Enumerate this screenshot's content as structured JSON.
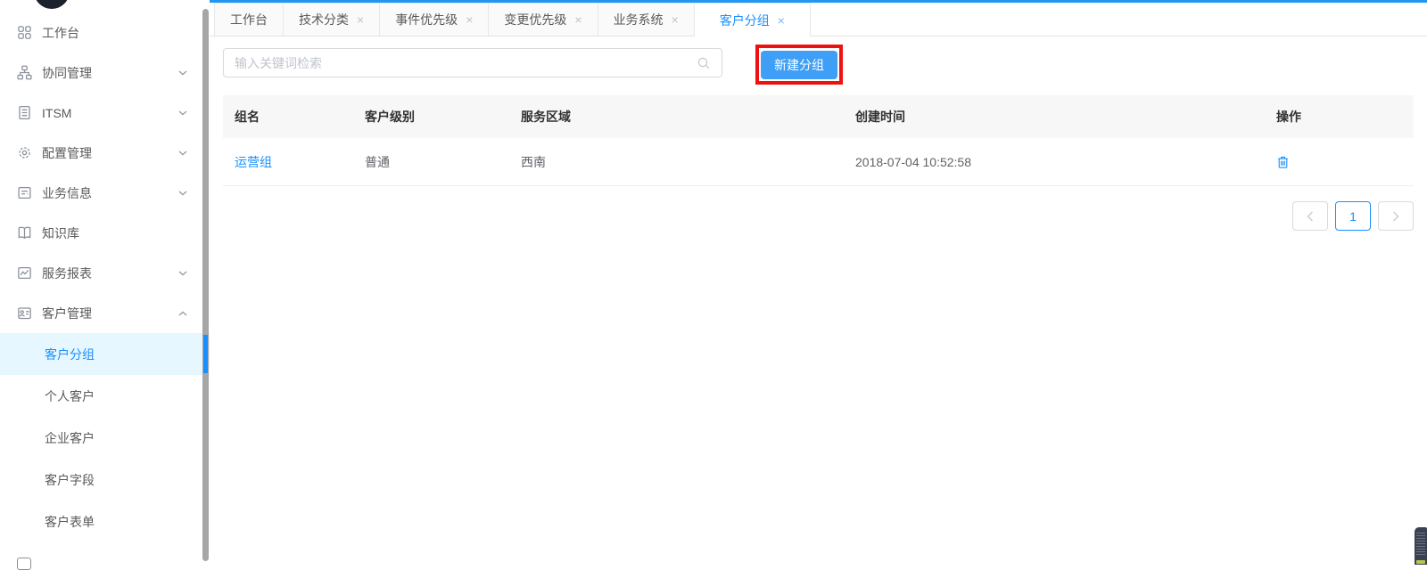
{
  "colors": {
    "accent": "#1890ff",
    "top_line": "#2196f3",
    "primary_button": "#3f9ef5",
    "annotation_box": "#ee1111",
    "active_item_bg": "#e6f7ff"
  },
  "sidebar": {
    "items": [
      {
        "label": "工作台",
        "icon": "grid-icon"
      },
      {
        "label": "协同管理",
        "icon": "org-chart-icon",
        "chevron": "down"
      },
      {
        "label": "ITSM",
        "icon": "document-icon",
        "chevron": "down"
      },
      {
        "label": "配置管理",
        "icon": "gear-icon",
        "chevron": "down"
      },
      {
        "label": "业务信息",
        "icon": "form-icon",
        "chevron": "down"
      },
      {
        "label": "知识库",
        "icon": "book-icon"
      },
      {
        "label": "服务报表",
        "icon": "report-chart-icon",
        "chevron": "down"
      },
      {
        "label": "客户管理",
        "icon": "id-card-icon",
        "chevron": "up",
        "expanded": true
      }
    ],
    "submenu": [
      {
        "label": "客户分组",
        "active": true
      },
      {
        "label": "个人客户"
      },
      {
        "label": "企业客户"
      },
      {
        "label": "客户字段"
      },
      {
        "label": "客户表单"
      }
    ]
  },
  "tabs": [
    {
      "label": "工作台",
      "closable": false
    },
    {
      "label": "技术分类",
      "closable": true
    },
    {
      "label": "事件优先级",
      "closable": true
    },
    {
      "label": "变更优先级",
      "closable": true
    },
    {
      "label": "业务系统",
      "closable": true
    },
    {
      "label": "客户分组",
      "closable": true,
      "active": true
    }
  ],
  "toolbar": {
    "search_placeholder": "输入关键词检索",
    "search_value": "",
    "new_group_button": "新建分组"
  },
  "table": {
    "columns": [
      "组名",
      "客户级别",
      "服务区域",
      "创建时间",
      "操作"
    ],
    "rows": [
      {
        "group_name": "运营组",
        "customer_level": "普通",
        "service_region": "西南",
        "created_at": "2018-07-04 10:52:58",
        "action_icon": "trash-icon"
      }
    ]
  },
  "pagination": {
    "prev_icon": "chevron-left-icon",
    "current_page": "1",
    "next_icon": "chevron-right-icon"
  }
}
